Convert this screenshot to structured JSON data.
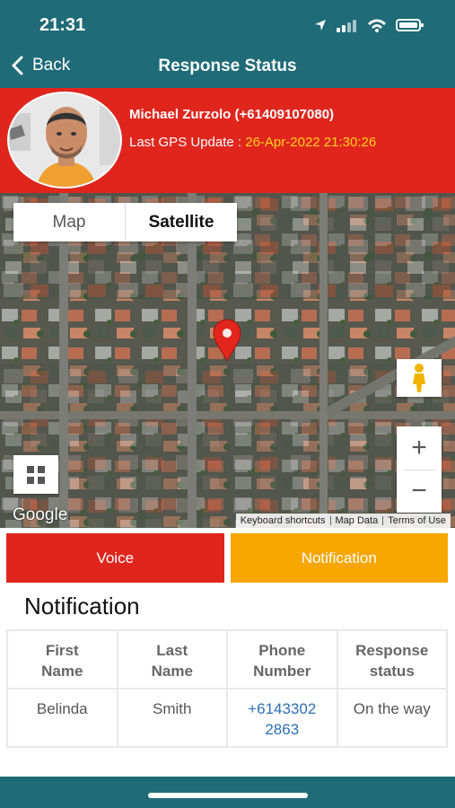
{
  "status_bar": {
    "time": "21:31"
  },
  "nav": {
    "back_label": "Back",
    "title": "Response Status"
  },
  "profile": {
    "name": "Michael Zurzolo (+61409107080)",
    "gps_label": "Last GPS Update : ",
    "gps_value": "26-Apr-2022 21:30:26"
  },
  "map": {
    "tabs": [
      "Map",
      "Satellite"
    ],
    "selected_tab": "Satellite",
    "google_label": "Google",
    "attribution": [
      "Keyboard shortcuts",
      "Map Data",
      "Terms of Use"
    ]
  },
  "actions": {
    "voice_label": "Voice",
    "notification_label": "Notification"
  },
  "notification": {
    "title": "Notification",
    "headers": [
      [
        "First",
        "Name"
      ],
      [
        "Last",
        "Name"
      ],
      [
        "Phone",
        "Number"
      ],
      [
        "Response",
        "status"
      ]
    ],
    "rows": [
      {
        "first_name": "Belinda",
        "last_name": "Smith",
        "phone_part1": "+6143302",
        "phone_part2": "2863",
        "response_status": "On the way"
      }
    ]
  },
  "colors": {
    "header_teal": "#1f6b78",
    "alert_red": "#e0251d",
    "notification_orange": "#f7a600",
    "gps_yellow": "#ffd21a",
    "link_blue": "#2c6fb3"
  },
  "icons": {
    "status": [
      "location-arrow-icon",
      "cellular-signal-icon",
      "wifi-icon",
      "battery-icon"
    ],
    "map": [
      "location-marker-icon",
      "pegman-icon",
      "zoom-in-icon",
      "zoom-out-icon",
      "map-layers-icon"
    ]
  }
}
